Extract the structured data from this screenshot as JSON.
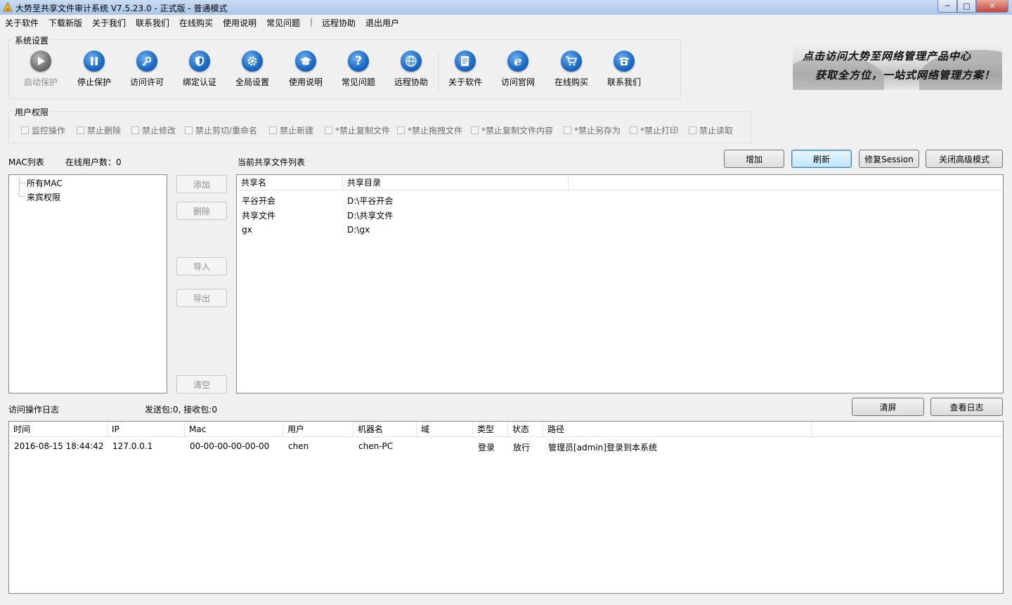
{
  "window": {
    "title": "大势至共享文件审计系统 V7.5.23.0 - 正式版 - 普通模式",
    "min_glyph": "─",
    "max_glyph": "□",
    "close_glyph": "✕"
  },
  "menu": {
    "items": [
      "关于软件",
      "下载新版",
      "关于我们",
      "联系我们",
      "在线购买",
      "使用说明",
      "常见问题",
      "|",
      "远程协助",
      "退出用户"
    ]
  },
  "system_settings": {
    "label": "系统设置",
    "tools": [
      {
        "label": "启动保护",
        "icon": "play-icon",
        "enabled": false
      },
      {
        "label": "停止保护",
        "icon": "pause-icon",
        "enabled": true
      },
      {
        "label": "访问许可",
        "icon": "key-icon",
        "enabled": true
      },
      {
        "label": "绑定认证",
        "icon": "shield-icon",
        "enabled": true
      },
      {
        "label": "全局设置",
        "icon": "gear-icon",
        "enabled": true
      },
      {
        "label": "使用说明",
        "icon": "graduation-cap-icon",
        "enabled": true
      },
      {
        "label": "常见问题",
        "icon": "question-icon",
        "enabled": true
      },
      {
        "label": "远程协助",
        "icon": "globe-icon",
        "enabled": true
      },
      {
        "label": "关于软件",
        "icon": "document-icon",
        "enabled": true
      },
      {
        "label": "访问官网",
        "icon": "browser-icon",
        "enabled": true
      },
      {
        "label": "在线购买",
        "icon": "cart-icon",
        "enabled": true
      },
      {
        "label": "联系我们",
        "icon": "phone-icon",
        "enabled": true
      }
    ]
  },
  "banner": {
    "line1": "点击访问大势至网络管理产品中心",
    "line2": "获取全方位，一站式网络管理方案！"
  },
  "user_permissions": {
    "label": "用户权限",
    "options": [
      "监控操作",
      "禁止删除",
      "禁止修改",
      "禁止剪切/重命名",
      "禁止新建",
      "*禁止复制文件",
      "*禁止拖拽文件",
      "*禁止复制文件内容",
      "*禁止另存为",
      "*禁止打印",
      "禁止读取"
    ]
  },
  "mac_list": {
    "label": "MAC列表",
    "online_users": "在线用户数：0",
    "tree": [
      "所有MAC",
      "来宾权限"
    ]
  },
  "side_buttons": {
    "add": "添加",
    "delete": "删除",
    "import": "导入",
    "export": "导出",
    "clear": "清空"
  },
  "shares": {
    "label": "当前共享文件列表",
    "buttons": {
      "add": "增加",
      "refresh": "刷新",
      "repair": "修复Session",
      "close_adv": "关闭高级模式"
    },
    "columns": [
      "共享名",
      "共享目录"
    ],
    "rows": [
      {
        "name": "平谷开会",
        "path": "D:\\平谷开会"
      },
      {
        "name": "共享文件",
        "path": "D:\\共享文件"
      },
      {
        "name": "gx",
        "path": "D:\\gx"
      }
    ]
  },
  "log": {
    "label": "访问操作日志",
    "packets": "发送包:0, 接收包:0",
    "buttons": {
      "clear": "清屏",
      "view": "查看日志"
    },
    "columns": [
      "时间",
      "IP",
      "Mac",
      "用户",
      "机器名",
      "域",
      "类型",
      "状态",
      "路径"
    ],
    "rows": [
      {
        "time": "2016-08-15 18:44:42",
        "ip": "127.0.0.1",
        "mac": "00-00-00-00-00-00",
        "user": "chen",
        "machine": "chen-PC",
        "domain": "",
        "type": "登录",
        "status": "放行",
        "path": "管理员[admin]登录到本系统"
      }
    ]
  }
}
